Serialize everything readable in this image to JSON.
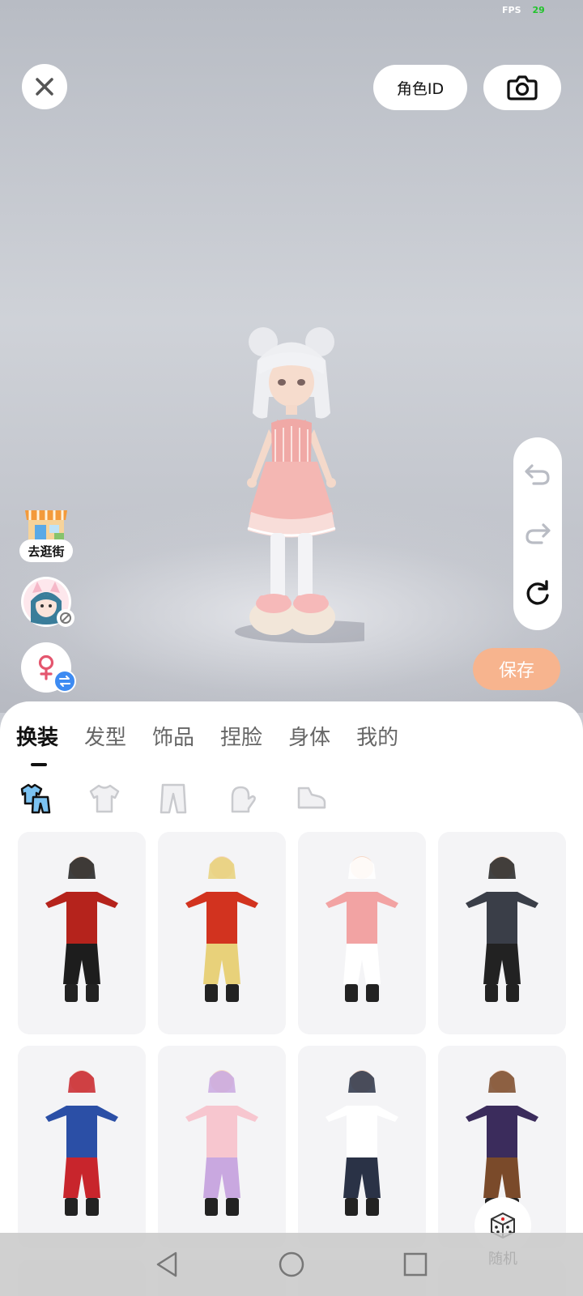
{
  "status": {
    "fps_label": "FPS",
    "fps_value": "29"
  },
  "top_bar": {
    "role_id_label": "角色ID"
  },
  "left_actions": {
    "shop_label": "去逛街"
  },
  "save_label": "保存",
  "tabs": [
    {
      "label": "换装",
      "active": true
    },
    {
      "label": "发型",
      "active": false
    },
    {
      "label": "饰品",
      "active": false
    },
    {
      "label": "捏脸",
      "active": false
    },
    {
      "label": "身体",
      "active": false
    },
    {
      "label": "我的",
      "active": false
    }
  ],
  "subcategories": [
    "outfit-set-icon",
    "top-icon",
    "pants-icon",
    "glove-icon",
    "shoe-icon"
  ],
  "outfits": [
    {
      "name": "red-qipao-outfit",
      "colors": [
        "#b5231c",
        "#1d1d1d"
      ]
    },
    {
      "name": "red-coat-outfit",
      "colors": [
        "#d2331f",
        "#e8d17a"
      ]
    },
    {
      "name": "pink-plaid-outfit",
      "colors": [
        "#f2a3a3",
        "#ffffff"
      ]
    },
    {
      "name": "black-suit-outfit",
      "colors": [
        "#3a3e48",
        "#222"
      ]
    },
    {
      "name": "blue-red-hero-outfit",
      "colors": [
        "#2b4fa6",
        "#c8252c"
      ]
    },
    {
      "name": "pink-cat-outfit",
      "colors": [
        "#f7c6cf",
        "#c9a8e0"
      ]
    },
    {
      "name": "tshirt-track-outfit",
      "colors": [
        "#ffffff",
        "#2a3246"
      ]
    },
    {
      "name": "purple-coat-outfit",
      "colors": [
        "#3b2c5c",
        "#7a4a2a"
      ]
    }
  ],
  "random_label": "随机",
  "colors": {
    "accent_save": "#f7b48e",
    "swap_badge": "#3d8bf2",
    "gender_icon": "#e4566e"
  }
}
